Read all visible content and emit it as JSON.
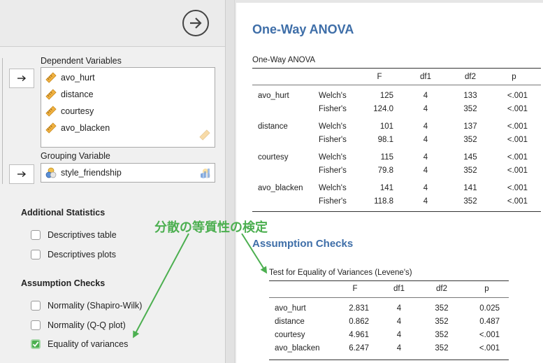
{
  "left_panel": {
    "dependent_label": "Dependent Variables",
    "dependent_vars": [
      "avo_hurt",
      "distance",
      "courtesy",
      "avo_blacken"
    ],
    "grouping_label": "Grouping Variable",
    "grouping_var": "style_friendship",
    "additional_heading": "Additional Statistics",
    "additional_options": [
      {
        "label": "Descriptives table",
        "checked": false
      },
      {
        "label": "Descriptives plots",
        "checked": false
      }
    ],
    "assumption_heading": "Assumption Checks",
    "assumption_options": [
      {
        "label": "Normality (Shapiro-Wilk)",
        "checked": false
      },
      {
        "label": "Normality (Q-Q plot)",
        "checked": false
      },
      {
        "label": "Equality of variances",
        "checked": true
      }
    ]
  },
  "annotation": "分散の等質性の検定",
  "results": {
    "title": "One-Way ANOVA",
    "anova_table": {
      "caption": "One-Way ANOVA",
      "headers": [
        "F",
        "df1",
        "df2",
        "p"
      ],
      "rows": [
        {
          "var": "avo_hurt",
          "test": "Welch's",
          "F": "125",
          "df1": "4",
          "df2": "133",
          "p": "<.001"
        },
        {
          "var": "",
          "test": "Fisher's",
          "F": "124.0",
          "df1": "4",
          "df2": "352",
          "p": "<.001"
        },
        {
          "var": "distance",
          "test": "Welch's",
          "F": "101",
          "df1": "4",
          "df2": "137",
          "p": "<.001"
        },
        {
          "var": "",
          "test": "Fisher's",
          "F": "98.1",
          "df1": "4",
          "df2": "352",
          "p": "<.001"
        },
        {
          "var": "courtesy",
          "test": "Welch's",
          "F": "115",
          "df1": "4",
          "df2": "145",
          "p": "<.001"
        },
        {
          "var": "",
          "test": "Fisher's",
          "F": "79.8",
          "df1": "4",
          "df2": "352",
          "p": "<.001"
        },
        {
          "var": "avo_blacken",
          "test": "Welch's",
          "F": "141",
          "df1": "4",
          "df2": "141",
          "p": "<.001"
        },
        {
          "var": "",
          "test": "Fisher's",
          "F": "118.8",
          "df1": "4",
          "df2": "352",
          "p": "<.001"
        }
      ]
    },
    "assumption_title": "Assumption Checks",
    "levene_table": {
      "caption": "Test for Equality of Variances (Levene's)",
      "headers": [
        "F",
        "df1",
        "df2",
        "p"
      ],
      "rows": [
        {
          "var": "avo_hurt",
          "F": "2.831",
          "df1": "4",
          "df2": "352",
          "p": "0.025"
        },
        {
          "var": "distance",
          "F": "0.862",
          "df1": "4",
          "df2": "352",
          "p": "0.487"
        },
        {
          "var": "courtesy",
          "F": "4.961",
          "df1": "4",
          "df2": "352",
          "p": "<.001"
        },
        {
          "var": "avo_blacken",
          "F": "6.247",
          "df1": "4",
          "df2": "352",
          "p": "<.001"
        }
      ]
    }
  },
  "colors": {
    "heading_blue": "#3e6ea8",
    "annotation_green": "#4caf50",
    "check_green": "#4bb04f",
    "ruler_orange": "#f0b140"
  },
  "icons": [
    "run-arrow-icon",
    "move-right-arrow-icon",
    "ruler-icon",
    "nominal-variable-icon",
    "bar-chart-icon",
    "checkmark-icon"
  ]
}
